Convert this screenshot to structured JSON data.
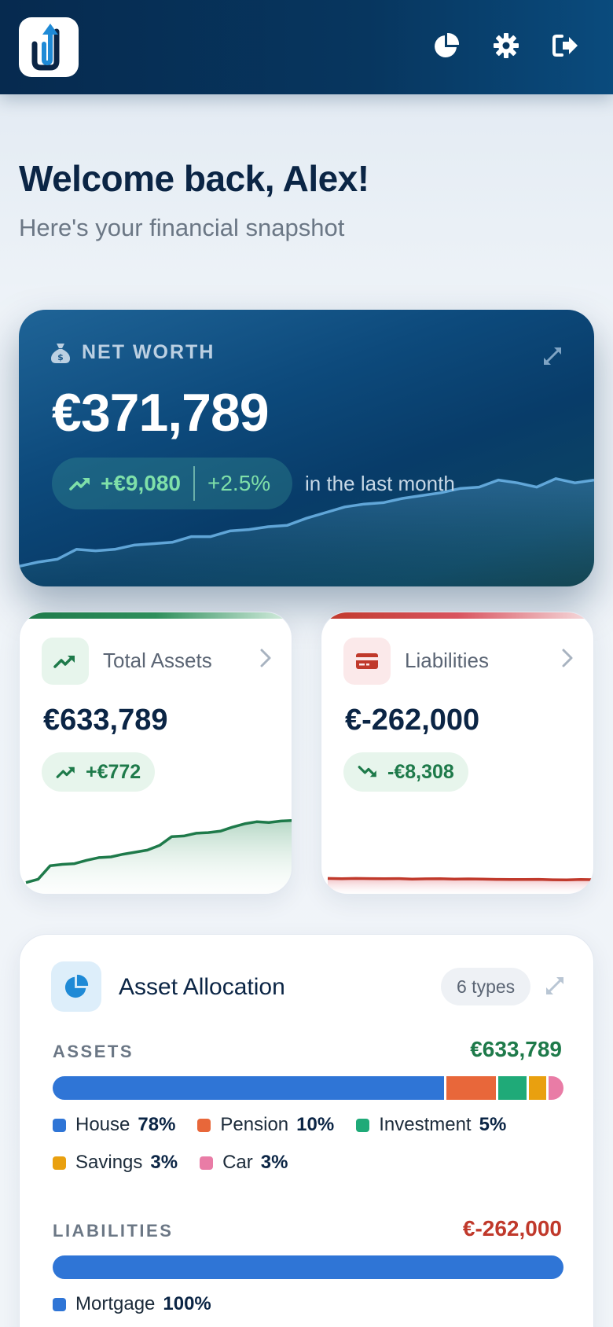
{
  "header": {
    "logo_icon": "paperclip-arrow-logo",
    "icons": [
      "pie-chart-icon",
      "gear-icon",
      "sign-out-icon"
    ]
  },
  "welcome": {
    "title": "Welcome back, Alex!",
    "subtitle": "Here's your financial snapshot"
  },
  "net_worth": {
    "label": "NET WORTH",
    "value": "€371,789",
    "change_amount": "+€9,080",
    "change_percent": "+2.5%",
    "period": "in the last month",
    "trend": [
      0.02,
      0.05,
      0.07,
      0.14,
      0.13,
      0.14,
      0.17,
      0.18,
      0.19,
      0.23,
      0.23,
      0.27,
      0.28,
      0.3,
      0.31,
      0.36,
      0.4,
      0.44,
      0.46,
      0.47,
      0.5,
      0.52,
      0.54,
      0.57,
      0.58,
      0.63,
      0.61,
      0.58,
      0.64,
      0.61,
      0.63
    ]
  },
  "assets_card": {
    "title": "Total Assets",
    "value": "€633,789",
    "change": "+€772",
    "accent": "#1e7a4a",
    "trend": [
      0.05,
      0.1,
      0.3,
      0.32,
      0.33,
      0.38,
      0.42,
      0.43,
      0.47,
      0.5,
      0.53,
      0.6,
      0.73,
      0.74,
      0.78,
      0.79,
      0.81,
      0.87,
      0.92,
      0.95,
      0.94,
      0.96,
      0.97
    ]
  },
  "liabilities_card": {
    "title": "Liabilities",
    "value": "€-262,000",
    "change": "-€8,308",
    "accent": "#c0392b",
    "trend": [
      0.62,
      0.6,
      0.62,
      0.61,
      0.6,
      0.61,
      0.57,
      0.59,
      0.6,
      0.56,
      0.58,
      0.56,
      0.54,
      0.53,
      0.53,
      0.54,
      0.51,
      0.5,
      0.53,
      0.52
    ]
  },
  "allocation": {
    "title": "Asset Allocation",
    "badge": "6 types",
    "assets_label": "ASSETS",
    "assets_total": "€633,789",
    "assets": [
      {
        "name": "House",
        "pct": "78%",
        "share": 78,
        "color": "#2f75d6"
      },
      {
        "name": "Pension",
        "pct": "10%",
        "share": 10,
        "color": "#e8673a"
      },
      {
        "name": "Investment",
        "pct": "5%",
        "share": 5.5,
        "color": "#1faa78"
      },
      {
        "name": "Savings",
        "pct": "3%",
        "share": 3.5,
        "color": "#e9a00f"
      },
      {
        "name": "Car",
        "pct": "3%",
        "share": 3,
        "color": "#e97ca6"
      }
    ],
    "liabilities_label": "LIABILITIES",
    "liabilities_total": "€-262,000",
    "liabilities": [
      {
        "name": "Mortgage",
        "pct": "100%",
        "share": 100,
        "color": "#2f75d6"
      }
    ]
  }
}
